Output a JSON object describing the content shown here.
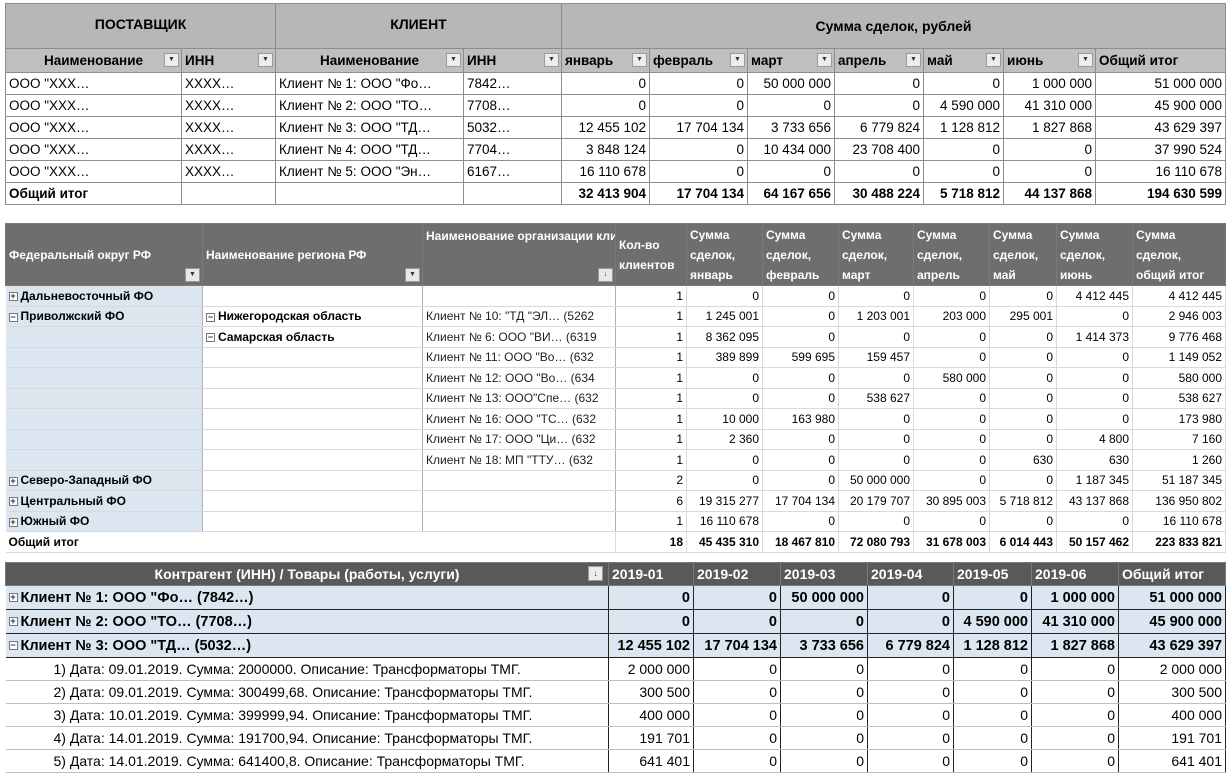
{
  "table1": {
    "groups": {
      "supplier": "ПОСТАВЩИК",
      "client": "КЛИЕНТ",
      "sum": "Сумма сделок, рублей"
    },
    "headers": [
      "Наименование",
      "ИНН",
      "Наименование",
      "ИНН",
      "январь",
      "февраль",
      "март",
      "апрель",
      "май",
      "июнь",
      "Общий итог"
    ],
    "rows": [
      [
        "ООО \"XXX…",
        "XXXX…",
        "Клиент № 1: ООО \"Фо…",
        "7842…",
        "0",
        "0",
        "50 000 000",
        "0",
        "0",
        "1 000 000",
        "51 000 000"
      ],
      [
        "ООО \"XXX…",
        "XXXX…",
        "Клиент № 2: ООО \"ТО…",
        "7708…",
        "0",
        "0",
        "0",
        "0",
        "4 590 000",
        "41 310 000",
        "45 900 000"
      ],
      [
        "ООО \"XXX…",
        "XXXX…",
        "Клиент № 3: ООО \"ТД…",
        "5032…",
        "12 455 102",
        "17 704 134",
        "3 733 656",
        "6 779 824",
        "1 128 812",
        "1 827 868",
        "43 629 397"
      ],
      [
        "ООО \"XXX…",
        "XXXX…",
        "Клиент № 4: ООО \"ТД…",
        "7704…",
        "3 848 124",
        "0",
        "10 434 000",
        "23 708 400",
        "0",
        "0",
        "37 990 524"
      ],
      [
        "ООО \"XXX…",
        "XXXX…",
        "Клиент № 5: ООО \"Эн…",
        "6167…",
        "16 110 678",
        "0",
        "0",
        "0",
        "0",
        "0",
        "16 110 678"
      ]
    ],
    "total": [
      "Общий итог",
      "",
      "",
      "",
      "32 413 904",
      "17 704 134",
      "64 167 656",
      "30 488 224",
      "5 718 812",
      "44 137 868",
      "194 630 599"
    ]
  },
  "table2": {
    "headers": [
      "Федеральный округ РФ",
      "Наименование региона РФ",
      "Наименование организации клиента (Ф.И.О. индивидуального",
      "Кол-во клиентов",
      "Сумма сделок, январь",
      "Сумма сделок, февраль",
      "Сумма сделок, март",
      "Сумма сделок, апрель",
      "Сумма сделок, май",
      "Сумма сделок, июнь",
      "Сумма сделок, общий итог"
    ],
    "rows": [
      {
        "c0": "Дальневосточный ФО",
        "e0": "+",
        "c1": "",
        "e1": "",
        "c2": "",
        "v": [
          "1",
          "0",
          "0",
          "0",
          "0",
          "0",
          "4 412 445",
          "4 412 445"
        ]
      },
      {
        "c0": "Приволжский ФО",
        "e0": "−",
        "c1": "Нижегородская область",
        "e1": "−",
        "c2": "Клиент № 10: \"ТД \"ЭЛ… (5262",
        "v": [
          "1",
          "1 245 001",
          "0",
          "1 203 001",
          "203 000",
          "295 001",
          "0",
          "2 946 003"
        ]
      },
      {
        "c0": "",
        "e0": "",
        "c1": "Самарская область",
        "e1": "−",
        "c2": "Клиент № 6: ООО \"ВИ… (6319",
        "v": [
          "1",
          "8 362 095",
          "0",
          "0",
          "0",
          "0",
          "1 414 373",
          "9 776 468"
        ]
      },
      {
        "c0": "",
        "e0": "",
        "c1": "",
        "e1": "",
        "c2": "Клиент № 11: ООО \"Во… (632",
        "v": [
          "1",
          "389 899",
          "599 695",
          "159 457",
          "0",
          "0",
          "0",
          "1 149 052"
        ]
      },
      {
        "c0": "",
        "e0": "",
        "c1": "",
        "e1": "",
        "c2": "Клиент № 12: ООО \"Во… (634",
        "v": [
          "1",
          "0",
          "0",
          "0",
          "580 000",
          "0",
          "0",
          "580 000"
        ]
      },
      {
        "c0": "",
        "e0": "",
        "c1": "",
        "e1": "",
        "c2": "Клиент № 13: ООО\"Спе… (632",
        "v": [
          "1",
          "0",
          "0",
          "538 627",
          "0",
          "0",
          "0",
          "538 627"
        ]
      },
      {
        "c0": "",
        "e0": "",
        "c1": "",
        "e1": "",
        "c2": "Клиент № 16: ООО \"ТС… (632",
        "v": [
          "1",
          "10 000",
          "163 980",
          "0",
          "0",
          "0",
          "0",
          "173 980"
        ]
      },
      {
        "c0": "",
        "e0": "",
        "c1": "",
        "e1": "",
        "c2": "Клиент № 17: ООО \"Ци… (632",
        "v": [
          "1",
          "2 360",
          "0",
          "0",
          "0",
          "0",
          "4 800",
          "7 160"
        ]
      },
      {
        "c0": "",
        "e0": "",
        "c1": "",
        "e1": "",
        "c2": "Клиент № 18: МП \"ТТУ… (632",
        "v": [
          "1",
          "0",
          "0",
          "0",
          "0",
          "630",
          "630",
          "1 260"
        ]
      },
      {
        "c0": "Северо-Западный ФО",
        "e0": "+",
        "c1": "",
        "e1": "",
        "c2": "",
        "v": [
          "2",
          "0",
          "0",
          "50 000 000",
          "0",
          "0",
          "1 187 345",
          "51 187 345"
        ]
      },
      {
        "c0": "Центральный ФО",
        "e0": "+",
        "c1": "",
        "e1": "",
        "c2": "",
        "v": [
          "6",
          "19 315 277",
          "17 704 134",
          "20 179 707",
          "30 895 003",
          "5 718 812",
          "43 137 868",
          "136 950 802"
        ]
      },
      {
        "c0": "Южный ФО",
        "e0": "+",
        "c1": "",
        "e1": "",
        "c2": "",
        "v": [
          "1",
          "16 110 678",
          "0",
          "0",
          "0",
          "0",
          "0",
          "16 110 678"
        ]
      }
    ],
    "total": {
      "label": "Общий итог",
      "v": [
        "18",
        "45 435 310",
        "18 467 810",
        "72 080 793",
        "31 678 003",
        "6 014 443",
        "50 157 462",
        "223 833 821"
      ]
    }
  },
  "table3": {
    "headers": [
      "Контрагент (ИНН) / Товары (работы, услуги)",
      "2019-01",
      "2019-02",
      "2019-03",
      "2019-04",
      "2019-05",
      "2019-06",
      "Общий итог"
    ],
    "clients": [
      {
        "name": "Клиент № 1: ООО \"Фо… (7842…)",
        "e": "+",
        "v": [
          "0",
          "0",
          "50 000 000",
          "0",
          "0",
          "1 000 000",
          "51 000 000"
        ]
      },
      {
        "name": "Клиент № 2: ООО \"ТО… (7708…)",
        "e": "+",
        "v": [
          "0",
          "0",
          "0",
          "0",
          "4 590 000",
          "41 310 000",
          "45 900 000"
        ]
      },
      {
        "name": "Клиент № 3: ООО \"ТД… (5032…)",
        "e": "−",
        "v": [
          "12 455 102",
          "17 704 134",
          "3 733 656",
          "6 779 824",
          "1 128 812",
          "1 827 868",
          "43 629 397"
        ]
      }
    ],
    "details": [
      {
        "desc": "1) Дата: 09.01.2019. Сумма: 2000000. Описание: Трансформаторы ТМГ.",
        "v": [
          "2 000 000",
          "0",
          "0",
          "0",
          "0",
          "0",
          "2 000 000"
        ]
      },
      {
        "desc": "2) Дата: 09.01.2019. Сумма: 300499,68. Описание: Трансформаторы ТМГ.",
        "v": [
          "300 500",
          "0",
          "0",
          "0",
          "0",
          "0",
          "300 500"
        ]
      },
      {
        "desc": "3) Дата: 10.01.2019. Сумма: 399999,94. Описание: Трансформаторы ТМГ.",
        "v": [
          "400 000",
          "0",
          "0",
          "0",
          "0",
          "0",
          "400 000"
        ]
      },
      {
        "desc": "4) Дата: 14.01.2019. Сумма: 191700,94. Описание: Трансформаторы ТМГ.",
        "v": [
          "191 701",
          "0",
          "0",
          "0",
          "0",
          "0",
          "191 701"
        ]
      },
      {
        "desc": "5) Дата: 14.01.2019. Сумма: 641400,8. Описание: Трансформаторы ТМГ.",
        "v": [
          "641 401",
          "0",
          "0",
          "0",
          "0",
          "0",
          "641 401"
        ]
      }
    ]
  },
  "icons": {
    "filter": "filter-dropdown-icon",
    "sort": "sort-descending-icon",
    "expand": "expand-plus-icon",
    "collapse": "collapse-minus-icon"
  },
  "colors": {
    "header_gray": "#bfbfbf",
    "group_gray": "#b7b7b7",
    "dark_header": "#6e6e6e",
    "darker_header": "#595959",
    "row_blue": "#dce6f1"
  }
}
